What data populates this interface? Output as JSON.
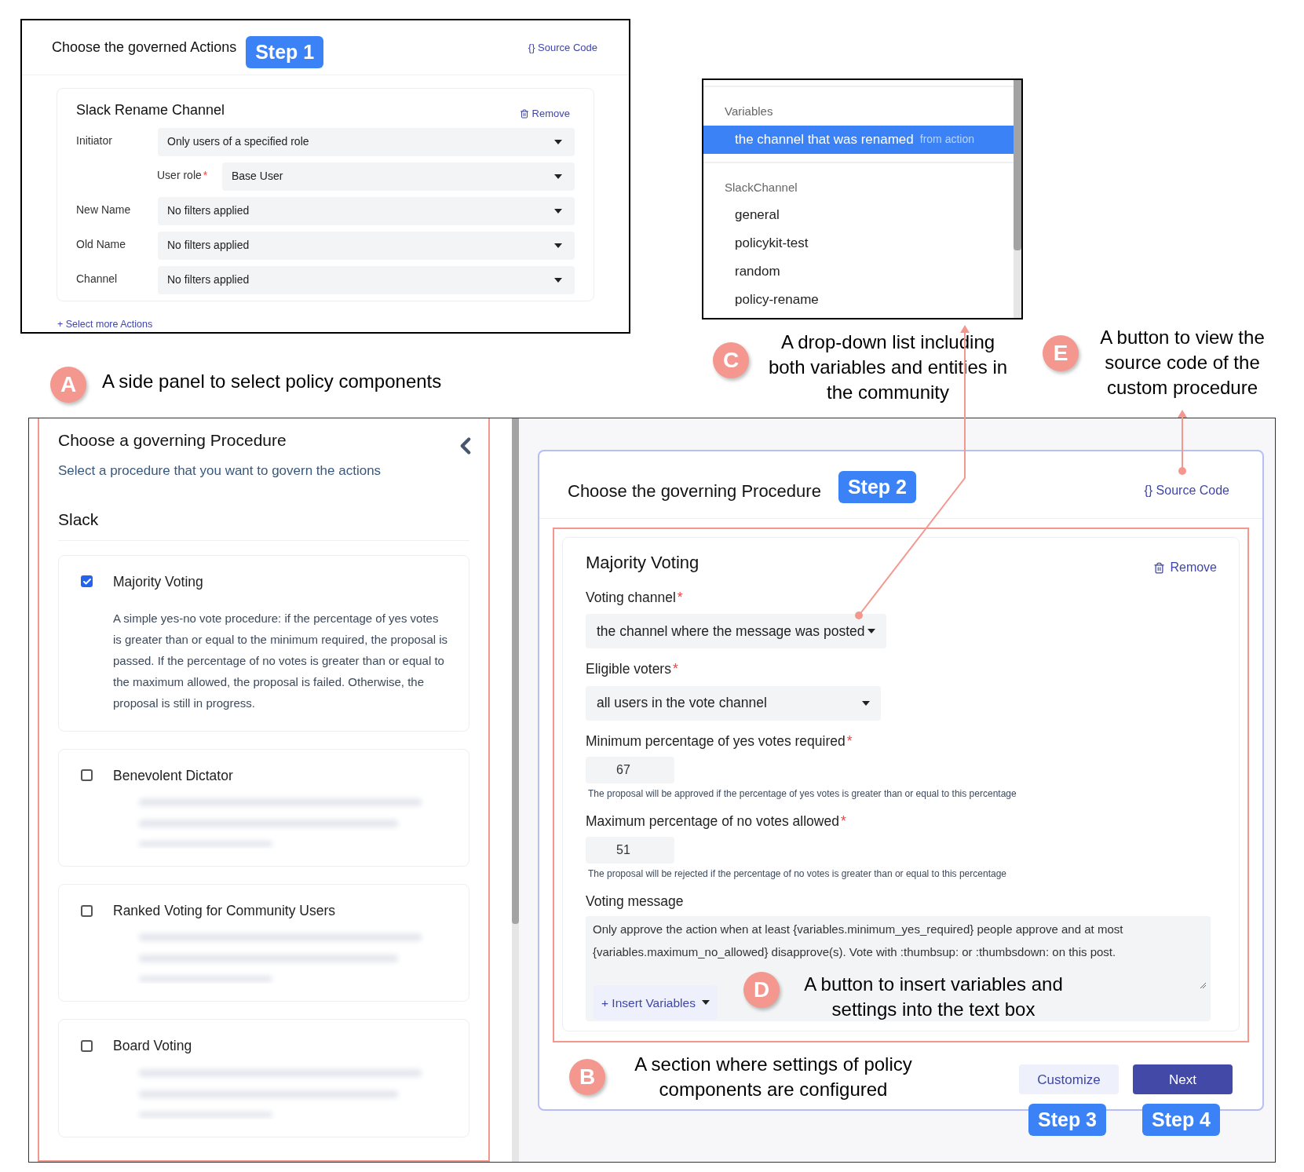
{
  "actions_panel": {
    "title": "Choose the governed Actions",
    "step_badge": "Step 1",
    "source_code_link": "{} Source Code",
    "action": {
      "title": "Slack Rename Channel",
      "remove_link": "Remove",
      "filters": [
        {
          "label": "Initiator",
          "value": "Only users of a specified role",
          "kind": "main"
        },
        {
          "label": "User role",
          "value": "Base User",
          "required_mark": "*",
          "kind": "sub"
        },
        {
          "label": "New Name",
          "value": "No filters applied",
          "kind": "main"
        },
        {
          "label": "Old Name",
          "value": "No filters applied",
          "kind": "main"
        },
        {
          "label": "Channel",
          "value": "No filters applied",
          "kind": "main"
        }
      ]
    },
    "select_more_link": "+ Select more Actions"
  },
  "dropdown": {
    "groups": [
      {
        "heading": "Variables",
        "items": [
          {
            "label": "the channel that was renamed",
            "note": "from action",
            "selected": true
          }
        ]
      },
      {
        "heading": "SlackChannel",
        "items": [
          {
            "label": "general",
            "selected": false
          },
          {
            "label": "policykit-test",
            "selected": false
          },
          {
            "label": "random",
            "selected": false
          },
          {
            "label": "policy-rename",
            "selected": false
          }
        ]
      }
    ]
  },
  "side_panel": {
    "title": "Choose a governing Procedure",
    "subtitle": "Select a procedure that you want to govern the actions",
    "section": "Slack",
    "procedures": [
      {
        "name": "Majority Voting",
        "checked": true,
        "blurred": false,
        "description": "A simple yes-no vote procedure: if the percentage of yes votes is greater than or equal to the minimum required, the proposal is passed. If the percentage of no votes is greater than or equal to the maximum allowed, the proposal is failed. Otherwise, the proposal is still in progress."
      },
      {
        "name": "Benevolent Dictator",
        "checked": false,
        "blurred": true
      },
      {
        "name": "Ranked Voting for Community Users",
        "checked": false,
        "blurred": true
      },
      {
        "name": "Board Voting",
        "checked": false,
        "blurred": true
      }
    ]
  },
  "procedure_panel": {
    "title": "Choose the governing Procedure",
    "step_badge": "Step 2",
    "source_code_link": "{} Source Code",
    "procedure": {
      "title": "Majority Voting",
      "remove_link": "Remove",
      "fields": [
        {
          "kind": "select",
          "label": "Voting channel",
          "required_mark": "*",
          "value": "the channel where the message was posted"
        },
        {
          "kind": "select_wide",
          "label": "Eligible voters",
          "required_mark": "*",
          "value": "all users in the vote channel"
        },
        {
          "kind": "number",
          "label": "Minimum percentage of yes votes required",
          "required_mark": "*",
          "value": "67",
          "help": "The proposal will be approved if the percentage of yes votes is greater than or equal to this percentage"
        },
        {
          "kind": "number",
          "label": "Maximum percentage of no votes allowed",
          "required_mark": "*",
          "value": "51",
          "help": "The proposal will be rejected if the percentage of no votes is greater than or equal to this percentage"
        },
        {
          "kind": "textarea",
          "label": "Voting message",
          "value": "Only approve the action when at least  {variables.minimum_yes_required} people approve and at most {variables.maximum_no_allowed} disapprove(s). Vote with :thumbsup: or :thumbsdown: on this post.",
          "insert_button": "+ Insert Variables"
        }
      ]
    },
    "buttons": [
      {
        "label": "Customize",
        "kind": "secondary"
      },
      {
        "label": "Next",
        "kind": "primary"
      }
    ],
    "button_step_badges": [
      "Step 3",
      "Step 4"
    ]
  },
  "annotations": [
    {
      "marker": "A",
      "text": "A side panel to select policy components"
    },
    {
      "marker": "C",
      "text": "A drop-down list including both variables and entities in the community"
    },
    {
      "marker": "E",
      "text": "A button to view the source code of the custom procedure"
    },
    {
      "marker": "D",
      "text": "A button to insert variables and settings into the text box"
    },
    {
      "marker": "B",
      "text": "A section where settings of policy components are configured"
    }
  ]
}
